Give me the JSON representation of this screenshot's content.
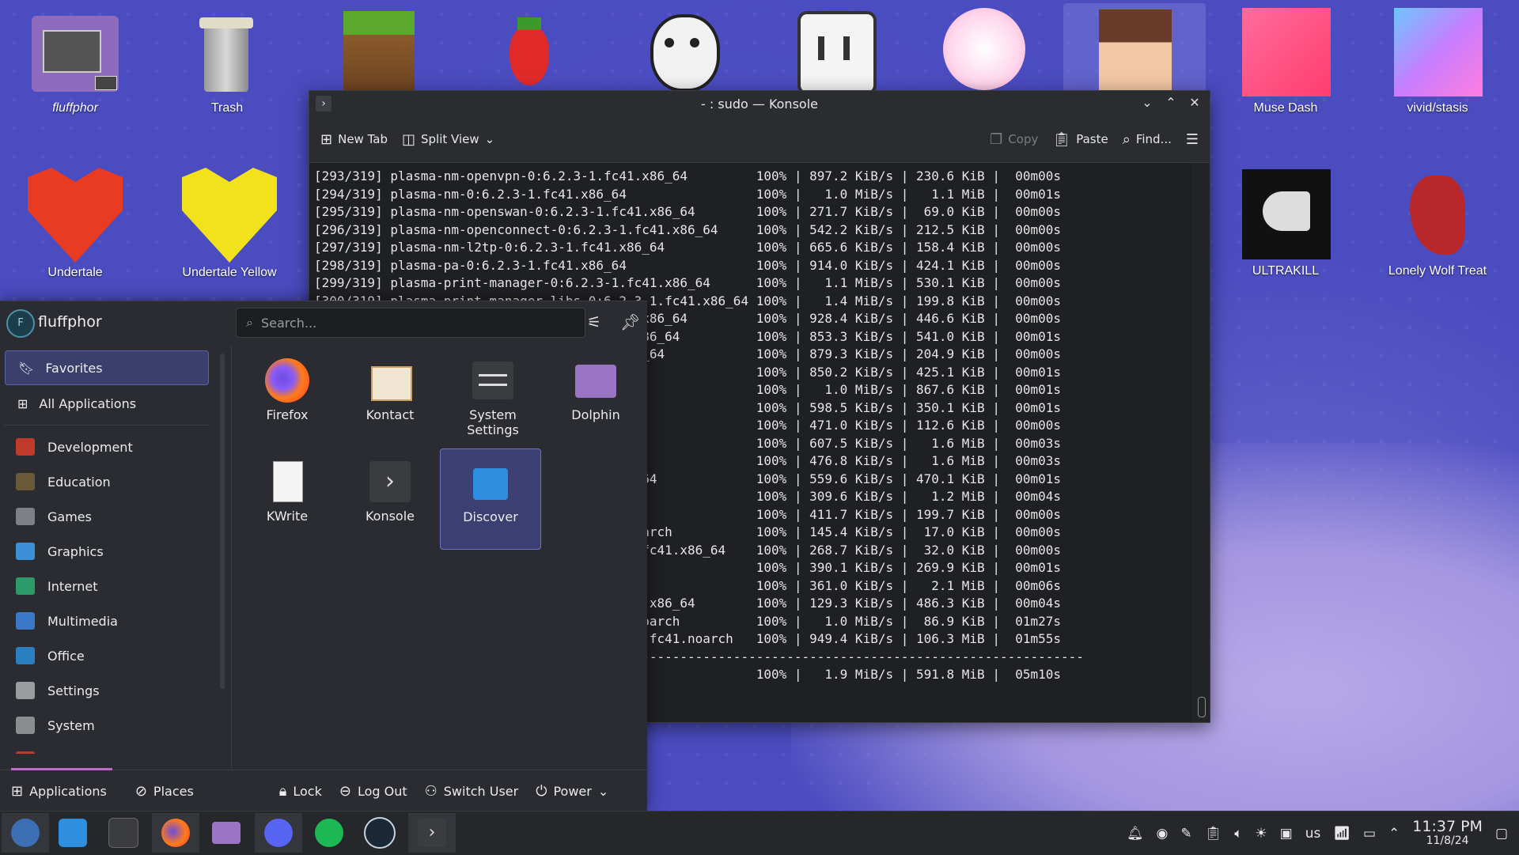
{
  "desktop": {
    "icons": [
      {
        "label": "fluffphor"
      },
      {
        "label": "Trash"
      },
      {
        "label": ""
      },
      {
        "label": ""
      },
      {
        "label": ""
      },
      {
        "label": ""
      },
      {
        "label": ""
      },
      {
        "label": ""
      },
      {
        "label": "Muse Dash"
      },
      {
        "label": "vivid/stasis"
      },
      {
        "label": "Undertale"
      },
      {
        "label": "Undertale Yellow"
      },
      {
        "label": "ULTRAKILL"
      },
      {
        "label": "Lonely Wolf Treat"
      }
    ],
    "colors": {
      "background": "#4a4cc0",
      "heart_red": "#e83b22",
      "heart_yellow": "#f2e21c"
    }
  },
  "konsole": {
    "title": "- : sudo — Konsole",
    "toolbar": {
      "new_tab": "New Tab",
      "split_view": "Split View",
      "copy": "Copy",
      "paste": "Paste",
      "find": "Find..."
    },
    "lines": [
      "[293/319] plasma-nm-openvpn-0:6.2.3-1.fc41.x86_64         100% | 897.2 KiB/s | 230.6 KiB |  00m00s",
      "[294/319] plasma-nm-0:6.2.3-1.fc41.x86_64                 100% |   1.0 MiB/s |   1.1 MiB |  00m01s",
      "[295/319] plasma-nm-openswan-0:6.2.3-1.fc41.x86_64        100% | 271.7 KiB/s |  69.0 KiB |  00m00s",
      "[296/319] plasma-nm-openconnect-0:6.2.3-1.fc41.x86_64     100% | 542.2 KiB/s | 212.5 KiB |  00m00s",
      "[297/319] plasma-nm-l2tp-0:6.2.3-1.fc41.x86_64            100% | 665.6 KiB/s | 158.4 KiB |  00m00s",
      "[298/319] plasma-pa-0:6.2.3-1.fc41.x86_64                 100% | 914.0 KiB/s | 424.1 KiB |  00m00s",
      "[299/319] plasma-print-manager-0:6.2.3-1.fc41.x86_64      100% |   1.1 MiB/s | 530.1 KiB |  00m00s",
      "[300/319] plasma-print-manager-libs-0:6.2.3-1.fc41.x86_64 100% |   1.4 MiB/s | 199.8 KiB |  00m00s",
      "                                      fc41.x86_64         100% | 928.4 KiB/s | 446.6 KiB |  00m00s",
      "                                      c41.x86_64          100% | 853.3 KiB/s | 541.0 KiB |  00m01s",
      "                                      1.x86_64            100% | 879.3 KiB/s | 204.9 KiB |  00m00s",
      "                                      54                  100% | 850.2 KiB/s | 425.1 KiB |  00m01s",
      "                                      5_64                100% |   1.0 MiB/s | 867.6 KiB |  00m01s",
      "                                      5_64                100% | 598.5 KiB/s | 350.1 KiB |  00m01s",
      "                                                          100% | 471.0 KiB/s | 112.6 KiB |  00m00s",
      "                                                          100% | 607.5 KiB/s |   1.6 MiB |  00m03s",
      "                                      36_64               100% | 476.8 KiB/s |   1.6 MiB |  00m03s",
      "                                      .x86_64             100% | 559.6 KiB/s | 470.1 KiB |  00m01s",
      "                                      n                   100% | 309.6 KiB/s |   1.2 MiB |  00m04s",
      "                                                          100% | 411.7 KiB/s | 199.7 KiB |  00m00s",
      "                                      41.noarch           100% | 145.4 KiB/s |  17.0 KiB |  00m00s",
      "                                      .3-1.fc41.x86_64    100% | 268.7 KiB/s |  32.0 KiB |  00m00s",
      "                                                          100% | 390.1 KiB/s | 269.9 KiB |  00m01s",
      "                                      4                   100% | 361.0 KiB/s |   2.1 MiB |  00m06s",
      "                                      .fc41.x86_64        100% | 129.3 KiB/s | 486.3 KiB |  00m04s",
      "                                      c41.noarch          100% |   1.0 MiB/s |  86.9 KiB |  01m27s",
      "                                      2.3-1.fc41.noarch   100% | 949.4 KiB/s | 106.3 MiB |  01m55s",
      "                                      ---------------------------------------------------------------",
      "                                                          100% |   1.9 MiB/s | 591.8 MiB |  05m10s"
    ]
  },
  "launcher": {
    "user": "fluffphor",
    "avatar_letter": "F",
    "search_placeholder": "Search...",
    "sidebar": {
      "favorites": "Favorites",
      "all_apps": "All Applications",
      "categories": [
        {
          "label": "Development",
          "color": "#c0392b"
        },
        {
          "label": "Education",
          "color": "#6b5a3a"
        },
        {
          "label": "Games",
          "color": "#7d8088"
        },
        {
          "label": "Graphics",
          "color": "#3d8fd8"
        },
        {
          "label": "Internet",
          "color": "#2d9a6a"
        },
        {
          "label": "Multimedia",
          "color": "#3a78c8"
        },
        {
          "label": "Office",
          "color": "#2a7fc0"
        },
        {
          "label": "Settings",
          "color": "#9a9ca0"
        },
        {
          "label": "System",
          "color": "#8a8c90"
        },
        {
          "label": "Utilities",
          "color": "#c0392b"
        }
      ]
    },
    "apps": [
      {
        "label": "Firefox"
      },
      {
        "label": "Kontact"
      },
      {
        "label": "System Settings"
      },
      {
        "label": "Dolphin"
      },
      {
        "label": "KWrite"
      },
      {
        "label": "Konsole"
      },
      {
        "label": "Discover"
      }
    ],
    "footer": {
      "applications": "Applications",
      "places": "Places",
      "lock": "Lock",
      "logout": "Log Out",
      "switch_user": "Switch User",
      "power": "Power"
    }
  },
  "taskbar": {
    "keyboard_layout": "us",
    "time": "11:37 PM",
    "date": "11/8/24"
  }
}
